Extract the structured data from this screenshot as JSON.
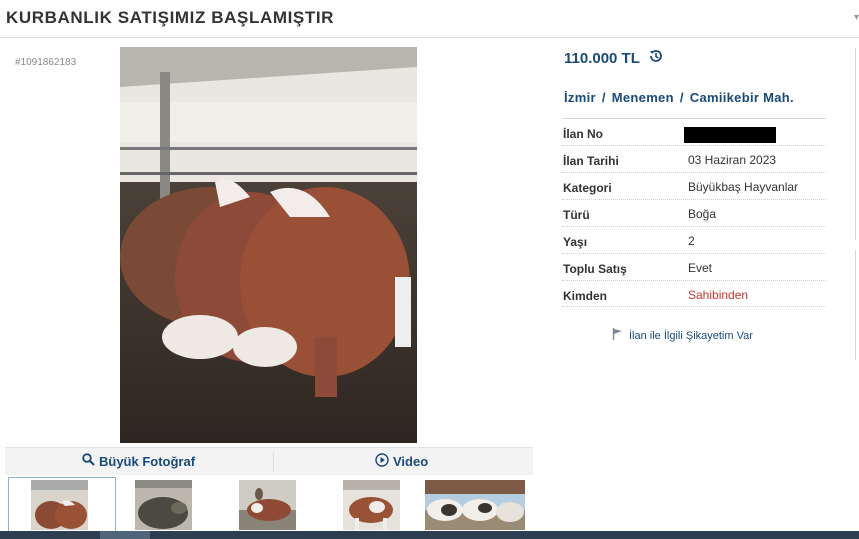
{
  "header": {
    "title": "KURBANLIK SATIŞIMIZ BAŞLAMIŞTIR"
  },
  "listing": {
    "id_label": "#1091862183"
  },
  "price": {
    "value": "110.000 TL",
    "history_icon": "history-icon"
  },
  "location": {
    "city": "İzmir",
    "district": "Menemen",
    "neighborhood": "Camiikebir Mah.",
    "separator": "/"
  },
  "details": [
    {
      "label": "İlan No",
      "value": "",
      "redacted": true
    },
    {
      "label": "İlan Tarihi",
      "value": "03 Haziran 2023"
    },
    {
      "label": "Kategori",
      "value": "Büyükbaş Hayvanlar"
    },
    {
      "label": "Türü",
      "value": "Boğa"
    },
    {
      "label": "Yaşı",
      "value": "2"
    },
    {
      "label": "Toplu Satış",
      "value": "Evet"
    },
    {
      "label": "Kimden",
      "value": "Sahibinden",
      "color": "#c0392b"
    }
  ],
  "photo_actions": {
    "big_photo": {
      "label": "Büyük Fotoğraf",
      "icon": "magnifier-icon"
    },
    "video": {
      "label": "Video",
      "icon": "play-circle-icon"
    }
  },
  "complaint": {
    "label": "İlan ile İlgili Şikayetim Var",
    "icon": "flag-icon"
  },
  "colors": {
    "link_blue": "#1a4a7a",
    "seller_red": "#c0392b",
    "bottom_bar": "#2d3e50"
  }
}
